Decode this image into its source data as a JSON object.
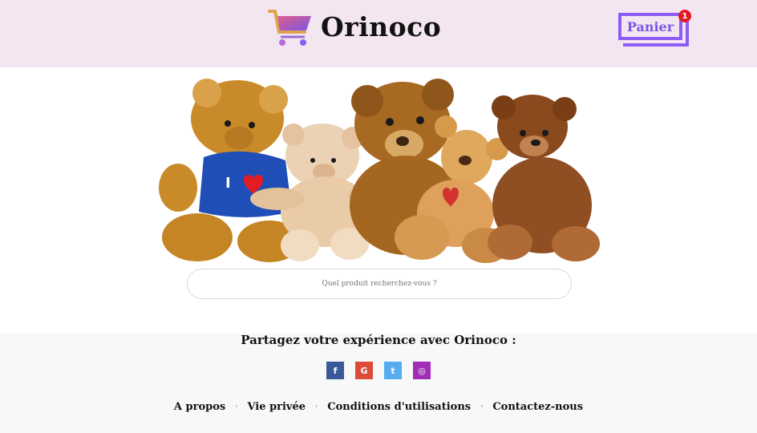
{
  "header": {
    "brand": "Orinoco",
    "cart_label": "Panier",
    "cart_count": "1",
    "colors": {
      "background": "#f3e6f0",
      "accent": "#8c5cf6",
      "badge": "#e31b23"
    }
  },
  "hero": {
    "icon": "teddy-bears-image"
  },
  "search": {
    "placeholder": "Quel produit recherchez-vous ?"
  },
  "footer": {
    "share_title": "Partagez votre expérience avec Orinoco :",
    "socials": [
      {
        "label": "f",
        "icon": "facebook-icon",
        "color": "#3b5998"
      },
      {
        "label": "G",
        "icon": "google-icon",
        "color": "#dd4b39"
      },
      {
        "label": "t",
        "icon": "twitter-icon",
        "color": "#55acee"
      },
      {
        "label": "◎",
        "icon": "instagram-icon",
        "color": "#a02cb7"
      }
    ],
    "links": [
      {
        "label": "A propos"
      },
      {
        "label": "Vie privée"
      },
      {
        "label": "Conditions d'utilisations"
      },
      {
        "label": "Contactez-nous"
      }
    ],
    "separator": "·"
  }
}
